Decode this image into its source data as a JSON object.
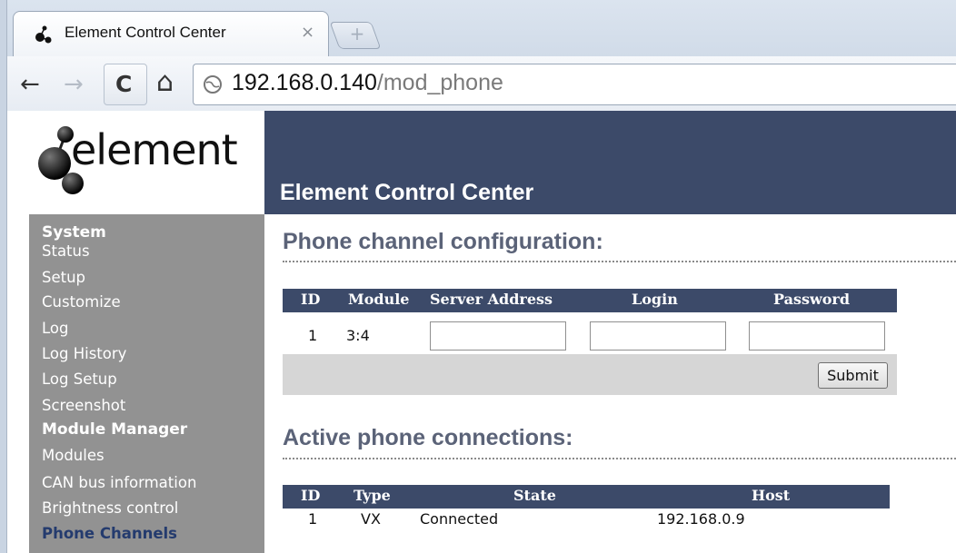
{
  "browser": {
    "tab_title": "Element Control Center",
    "tab_close": "×",
    "new_tab": "+",
    "url_host": "192.168.0.140",
    "url_path": "/mod_phone",
    "icons": {
      "back": "←",
      "forward": "→",
      "reload": "C",
      "home": "⌂"
    }
  },
  "header": {
    "logo_text": "element",
    "title": "Element Control Center"
  },
  "sidebar": {
    "sections": [
      {
        "title": "System",
        "items": [
          "Status",
          "Setup",
          "Customize",
          "Log",
          "Log History",
          "Log Setup",
          "Screenshot"
        ]
      },
      {
        "title": "Module Manager",
        "items": [
          "Modules",
          "CAN bus information",
          "Brightness control",
          "Phone Channels"
        ]
      }
    ],
    "active_item": "Phone Channels"
  },
  "phone_config": {
    "title": "Phone channel configuration:",
    "columns": [
      "ID",
      "Module",
      "Server Address",
      "Login",
      "Password"
    ],
    "rows": [
      {
        "id": "1",
        "module": "3:4",
        "server_address": "",
        "login": "",
        "password": ""
      }
    ],
    "submit_label": "Submit"
  },
  "active_connections": {
    "title": "Active phone connections:",
    "columns": [
      "ID",
      "Type",
      "State",
      "Host"
    ],
    "rows": [
      {
        "id": "1",
        "type": "VX",
        "state": "Connected",
        "host": "192.168.0.9"
      }
    ]
  },
  "colors": {
    "header_bg": "#3c4a69",
    "sidebar_bg": "#929292",
    "section_title": "#5b6378",
    "active_link": "#243b6e"
  }
}
